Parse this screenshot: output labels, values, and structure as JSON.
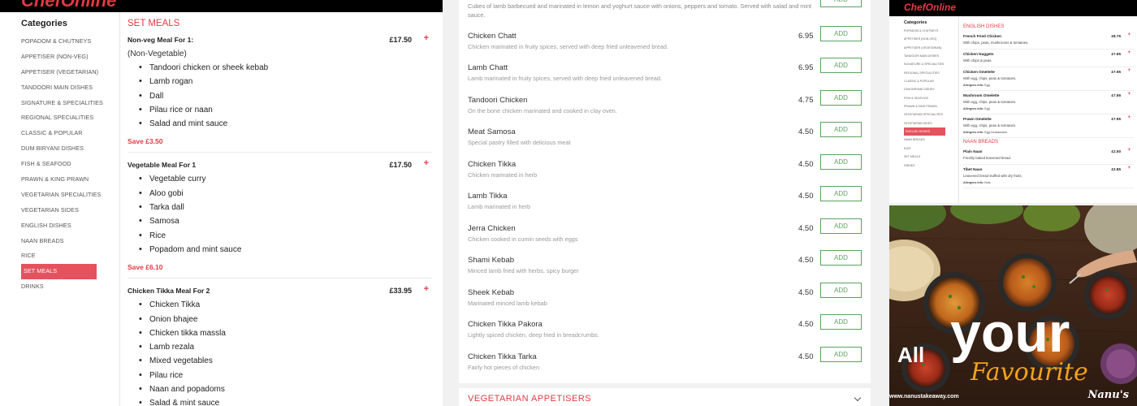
{
  "panel1": {
    "logo": "ChefOnline",
    "categories_title": "Categories",
    "categories": [
      "POPADOM & CHUTNEYS",
      "APPETISER (NON-VEG)",
      "APPETISER (VEGETARIAN)",
      "TANDOORI MAIN DISHES",
      "SIGNATURE & SPECIALITIES",
      "REGIONAL SPECIALITIES",
      "CLASSIC & POPULAR",
      "DUM BIRYANI DISHES",
      "FISH & SEAFOOD",
      "PRAWN & KING PRAWN",
      "VEGETARIAN SPECIALITIES",
      "VEGETARIAN SIDES",
      "ENGLISH DISHES",
      "NAAN BREADS",
      "RICE",
      "SET MEALS",
      "DRINKS"
    ],
    "active_category": "SET MEALS",
    "section_title": "SET MEALS",
    "meals": [
      {
        "name": "Non-veg Meal For 1:",
        "price": "£17.50",
        "subtitle": "(Non-Vegetable)",
        "items": [
          "Tandoori chicken or sheek kebab",
          "Lamb rogan",
          "Dall",
          "Pilau rice or naan",
          "Salad and mint sauce"
        ],
        "save": "Save £3.50"
      },
      {
        "name": "Vegetable Meal For 1",
        "price": "£17.50",
        "items": [
          "Vegetable curry",
          "Aloo gobi",
          "Tarka dall",
          "Samosa",
          "Rice",
          "Popadom and mint sauce"
        ],
        "save": "Save £6.10"
      },
      {
        "name": "Chicken Tikka Meal For 2",
        "price": "£33.95",
        "items": [
          "Chicken Tikka",
          "Onion bhajee",
          "Chicken tikka massla",
          "Lamb rezala",
          "Mixed vegetables",
          "Pilau rice",
          "Naan and popadoms",
          "Salad & mint sauce"
        ]
      }
    ]
  },
  "panel2": {
    "intro_desc": "Cubes of lamb barbecued and marinated in lemon and yoghurt sauce with onions, peppers and tomato. Served with salad and mint sauce.",
    "add_label": "ADD",
    "items": [
      {
        "name": "Chicken Chatt",
        "desc": "Chicken marinated in fruity spices, served with deep fried unleavened bread.",
        "price": "6.95"
      },
      {
        "name": "Lamb Chatt",
        "desc": "Lamb marinated in fruity spices, served with deep fried unleavened bread.",
        "price": "6.95"
      },
      {
        "name": "Tandoori Chicken",
        "desc": "On the bone chicken marinated and cooked in clay oven.",
        "price": "4.75"
      },
      {
        "name": "Meat Samosa",
        "desc": "Special pastry filled with delicious meat",
        "price": "4.50"
      },
      {
        "name": "Chicken Tikka",
        "desc": "Chicken marinated in herb",
        "price": "4.50"
      },
      {
        "name": "Lamb Tikka",
        "desc": "Lamb marinated in herb",
        "price": "4.50"
      },
      {
        "name": "Jerra Chicken",
        "desc": "Chicken cooked in cumin seeds with eggs",
        "price": "4.50"
      },
      {
        "name": "Shami Kebab",
        "desc": "Minced lamb fried with herbs, spicy burger",
        "price": "4.50"
      },
      {
        "name": "Sheek Kebab",
        "desc": "Marinated minced lamb kebab",
        "price": "4.50"
      },
      {
        "name": "Chicken Tikka Pakora",
        "desc": "Lightly spiced chicken, deep fried in breadcrumbs.",
        "price": "4.50"
      },
      {
        "name": "Chicken Tikka Tarka",
        "desc": "Fairly hot pieces of chicken",
        "price": "4.50"
      }
    ],
    "next_section": "VEGETARIAN APPETISERS"
  },
  "panel3": {
    "logo": "ChefOnline",
    "categories_title": "Categories",
    "categories": [
      "POPADOM & CHUTNEYS",
      "APPETISER (NON-VEG)",
      "APPETISER (VEGETARIAN)",
      "TANDOORI MAIN DISHES",
      "SIGNATURE & SPECIALITIES",
      "REGIONAL SPECIALITIES",
      "CLASSIC & POPULAR",
      "DUM BIRYANI DISHES",
      "FISH & SEAFOOD",
      "PRAWN & KING PRAWN",
      "VEGETARIAN SPECIALITIES",
      "VEGETARIAN SIDES",
      "ENGLISH DISHES",
      "NAAN BREADS",
      "RICE",
      "SET MEALS",
      "DRINKS"
    ],
    "active_category": "ENGLISH DISHES",
    "allergens_label": "Allergens Info:",
    "sections": [
      {
        "title": "ENGLISH DISHES",
        "items": [
          {
            "name": "French Fried Chicken",
            "desc": "With chips, peas, mushrooms & tomatoes.",
            "price": "£8.75"
          },
          {
            "name": "Chicken Nuggets",
            "desc": "With chips & peas.",
            "price": "£7.95"
          },
          {
            "name": "Chicken Omelette",
            "desc": "With egg, chips, peas & tomatoes.",
            "price": "£7.95",
            "allergens": "Egg"
          },
          {
            "name": "Mushroom Omelette",
            "desc": "With egg, chips, peas & tomatoes.",
            "price": "£7.95",
            "allergens": "Egg"
          },
          {
            "name": "Prawn Omelette",
            "desc": "With egg, chips, peas & tomatoes.",
            "price": "£7.95",
            "allergens": "Egg,Crustaceans"
          }
        ]
      },
      {
        "title": "NAAN BREADS",
        "items": [
          {
            "name": "Plain Naan",
            "desc": "Freshly baked leavened bread.",
            "price": "£2.50"
          },
          {
            "name": "Tibet Naan",
            "desc": "Leavened bread stuffed with dry fruits.",
            "price": "£2.85",
            "allergens": "Nuts"
          }
        ]
      }
    ]
  },
  "panel4": {
    "headline_1": "All",
    "headline_2": "your",
    "headline_3": "Favourite",
    "url": "www.nanustakeaway.com",
    "brand": "Nanu's"
  },
  "colors": {
    "accent": "#e23a43",
    "active_bg": "#e5525e",
    "add_green": "#5aa35f"
  }
}
